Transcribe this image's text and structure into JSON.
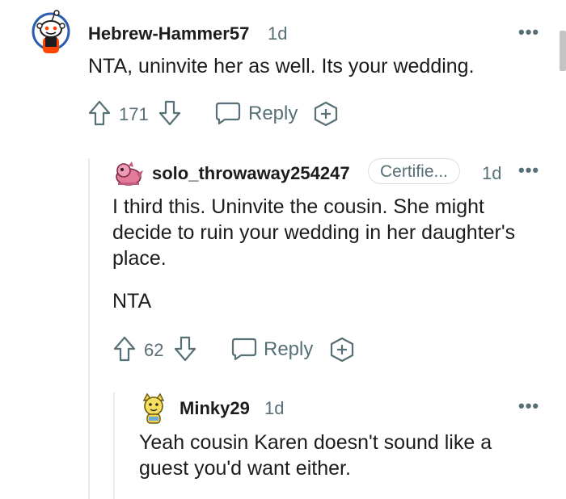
{
  "comment1": {
    "username": "Hebrew-Hammer57",
    "time": "1d",
    "text": "NTA, uninvite her as well. Its your wedding.",
    "votes": "171",
    "reply_label": "Reply",
    "avatar_icon": "reddit-snoo-avatar-icon"
  },
  "comment2": {
    "username": "solo_throwaway254247",
    "flair": "Certifie...",
    "time": "1d",
    "text_p1": "I third this. Uninvite the cousin. She might decide to ruin your wedding in her daughter's place.",
    "text_p2": "NTA",
    "votes": "62",
    "reply_label": "Reply",
    "avatar_icon": "pink-dragon-avatar-icon"
  },
  "comment3": {
    "username": "Minky29",
    "time": "1d",
    "text": "Yeah cousin Karen doesn't sound like a guest you'd want either.",
    "avatar_icon": "yellow-cat-avatar-icon"
  },
  "colors": {
    "meta": "#576f76",
    "text": "#1c1c1c",
    "thread_line": "#e5ebee"
  }
}
